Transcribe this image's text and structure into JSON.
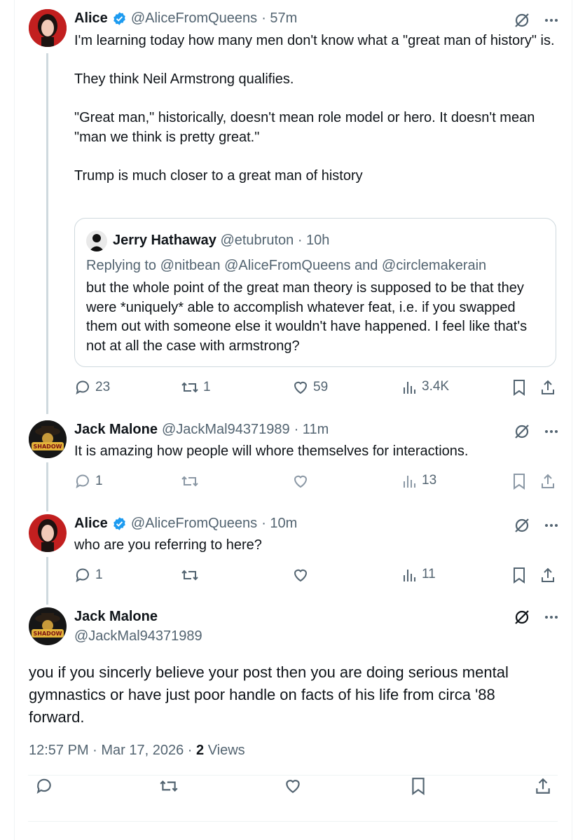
{
  "tweets": [
    {
      "name": "Alice",
      "handle": "@AliceFromQueens",
      "time": "· 57m",
      "text": "I'm learning today how many men don't know what a \"great man of history\" is.\n\nThey think Neil Armstrong qualifies.\n\n\"Great man,\" historically, doesn't mean role model or hero. It doesn't mean \"man we think is pretty great.\"\n\nTrump is much closer to a great man of history",
      "quote": {
        "name": "Jerry Hathaway",
        "handle": "@etubruton",
        "time": "· 10h",
        "reply_to": "Replying to @nitbean @AliceFromQueens and @circlemakerain",
        "text": "but the whole point of the great man theory is supposed to be that they were *uniquely* able to accomplish whatever feat, i.e. if you swapped them out with someone else it wouldn't have happened. I feel like that's not at all the case with armstrong?"
      },
      "replies": "23",
      "reposts": "1",
      "likes": "59",
      "views": "3.4K"
    },
    {
      "name": "Jack Malone",
      "handle": "@JackMal94371989",
      "time": "· 11m",
      "text": "It is amazing how people will whore themselves for interactions.",
      "replies": "1",
      "reposts": "",
      "likes": "",
      "views": "13"
    },
    {
      "name": "Alice",
      "handle": "@AliceFromQueens",
      "time": "· 10m",
      "text": "who are you referring to here?",
      "replies": "1",
      "reposts": "",
      "likes": "",
      "views": "11"
    }
  ],
  "main": {
    "name": "Jack Malone",
    "handle": "@JackMal94371989",
    "text": "you if you sincerly believe your post then you are doing serious mental gymnastics or have just poor handle on facts of his life from circa '88 forward.",
    "timestamp": "12:57 PM · Mar 17, 2026 · ",
    "views_count": "2",
    "views_label": " Views"
  },
  "avatar_text": "SHADOW KNOWS",
  "icons": [
    "verified-badge-icon",
    "grok-icon",
    "more-icon",
    "reply-icon",
    "repost-icon",
    "like-icon",
    "views-icon",
    "bookmark-icon",
    "share-icon"
  ],
  "colors": {
    "verified": "#1d9bf0",
    "text": "#0f1419",
    "secondary": "#536471",
    "border": "#cfd9de"
  }
}
